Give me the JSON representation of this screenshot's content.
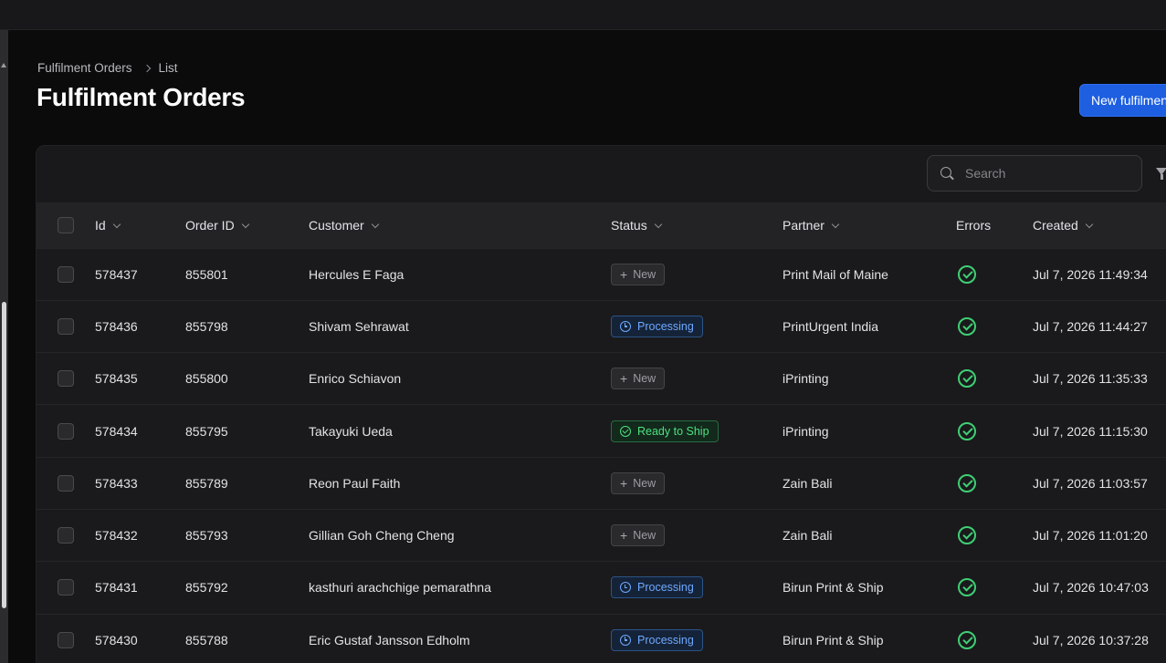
{
  "breadcrumb": {
    "root": "Fulfilment Orders",
    "current": "List"
  },
  "page": {
    "title": "Fulfilment Orders",
    "new_button": "New fulfilment order"
  },
  "search": {
    "placeholder": "Search"
  },
  "colors": {
    "accent": "#1d5fe0",
    "processing": "#6ea8ff",
    "ready": "#4ee07f",
    "ok": "#3fcf74"
  },
  "table": {
    "headers": {
      "id": "Id",
      "order_id": "Order ID",
      "customer": "Customer",
      "status": "Status",
      "partner": "Partner",
      "errors": "Errors",
      "created": "Created"
    },
    "rows": [
      {
        "id": "578437",
        "order_id": "855801",
        "customer": "Hercules E Faga",
        "status": "New",
        "status_type": "new",
        "partner": "Print Mail of Maine",
        "errors_icon": "check-circle-icon",
        "created": "Jul 7, 2026 11:49:34"
      },
      {
        "id": "578436",
        "order_id": "855798",
        "customer": "Shivam Sehrawat",
        "status": "Processing",
        "status_type": "processing",
        "partner": "PrintUrgent India",
        "errors_icon": "check-circle-icon",
        "created": "Jul 7, 2026 11:44:27"
      },
      {
        "id": "578435",
        "order_id": "855800",
        "customer": "Enrico Schiavon",
        "status": "New",
        "status_type": "new",
        "partner": "iPrinting",
        "errors_icon": "check-circle-icon",
        "created": "Jul 7, 2026 11:35:33"
      },
      {
        "id": "578434",
        "order_id": "855795",
        "customer": "Takayuki Ueda",
        "status": "Ready to Ship",
        "status_type": "ready",
        "partner": "iPrinting",
        "errors_icon": "check-circle-icon",
        "created": "Jul 7, 2026 11:15:30"
      },
      {
        "id": "578433",
        "order_id": "855789",
        "customer": "Reon Paul Faith",
        "status": "New",
        "status_type": "new",
        "partner": "Zain Bali",
        "errors_icon": "check-circle-icon",
        "created": "Jul 7, 2026 11:03:57"
      },
      {
        "id": "578432",
        "order_id": "855793",
        "customer": "Gillian Goh Cheng Cheng",
        "status": "New",
        "status_type": "new",
        "partner": "Zain Bali",
        "errors_icon": "check-circle-icon",
        "created": "Jul 7, 2026 11:01:20"
      },
      {
        "id": "578431",
        "order_id": "855792",
        "customer": "kasthuri arachchige pemarathna",
        "status": "Processing",
        "status_type": "processing",
        "partner": "Birun Print & Ship",
        "errors_icon": "check-circle-icon",
        "created": "Jul 7, 2026 10:47:03"
      },
      {
        "id": "578430",
        "order_id": "855788",
        "customer": "Eric Gustaf Jansson Edholm",
        "status": "Processing",
        "status_type": "processing",
        "partner": "Birun Print & Ship",
        "errors_icon": "check-circle-icon",
        "created": "Jul 7, 2026 10:37:28"
      }
    ]
  }
}
